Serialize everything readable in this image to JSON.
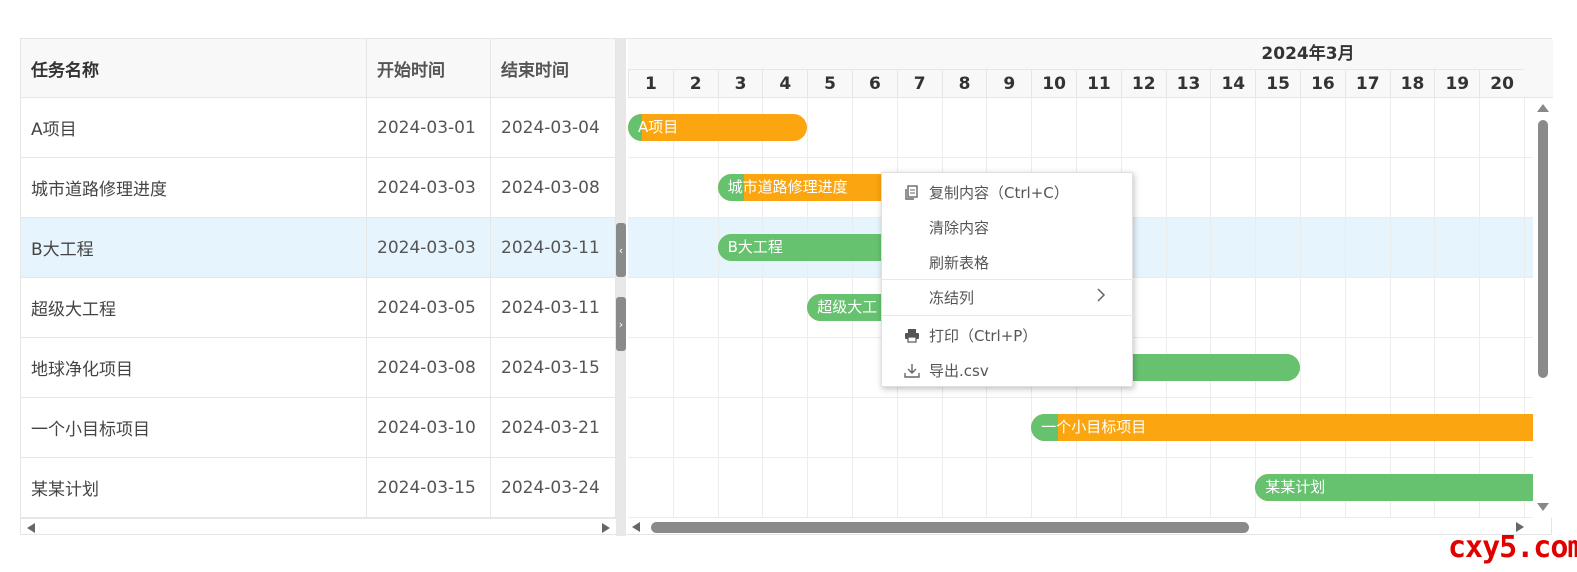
{
  "columns": [
    "任务名称",
    "开始时间",
    "结束时间"
  ],
  "month_label": "2024年3月",
  "days": [
    "1",
    "2",
    "3",
    "4",
    "5",
    "6",
    "7",
    "8",
    "9",
    "10",
    "11",
    "12",
    "13",
    "14",
    "15",
    "16",
    "17",
    "18",
    "19",
    "20"
  ],
  "rows": [
    {
      "name": "A项目",
      "start": "2024-03-01",
      "end": "2024-03-04"
    },
    {
      "name": "城市道路修理进度",
      "start": "2024-03-03",
      "end": "2024-03-08"
    },
    {
      "name": "B大工程",
      "start": "2024-03-03",
      "end": "2024-03-11"
    },
    {
      "name": "超级大工程",
      "start": "2024-03-05",
      "end": "2024-03-11"
    },
    {
      "name": "地球净化项目",
      "start": "2024-03-08",
      "end": "2024-03-15"
    },
    {
      "name": "一个小目标项目",
      "start": "2024-03-10",
      "end": "2024-03-21"
    },
    {
      "name": "某某计划",
      "start": "2024-03-15",
      "end": "2024-03-24"
    }
  ],
  "bars": [
    {
      "label": "A项目",
      "progress": 0.04
    },
    {
      "label": "城市道路修理进度",
      "progress": 0.1
    },
    {
      "label": "B大工程",
      "progress": 1.0
    },
    {
      "label": "超级大工",
      "progress": 0.4
    },
    {
      "label": "",
      "progress": 1.0
    },
    {
      "label": "一个小目标项目",
      "progress": 0.05
    },
    {
      "label": "某某计划",
      "progress": 1.0
    }
  ],
  "selected_row": 2,
  "context_menu": {
    "copy": "复制内容（Ctrl+C）",
    "clear": "清除内容",
    "refresh": "刷新表格",
    "freeze": "冻结列",
    "print": "打印（Ctrl+P）",
    "export": "导出.csv"
  },
  "watermark": "cxy5.com",
  "colors": {
    "progress": "#66c26e",
    "remaining": "#fba610",
    "selected_row": "#e6f5fd"
  }
}
